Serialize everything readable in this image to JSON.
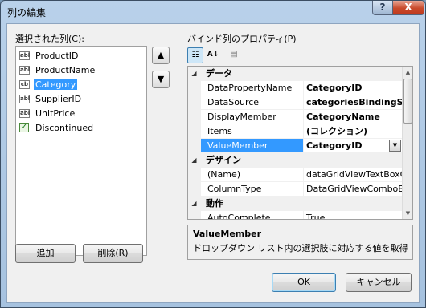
{
  "window": {
    "title": "列の編集",
    "help_glyph": "?",
    "close_glyph": "X"
  },
  "left": {
    "selected_columns_label": "選択された列(C):",
    "columns": [
      {
        "label": "ProductID",
        "icon": "textbox-column-icon",
        "icon_text": "abl"
      },
      {
        "label": "ProductName",
        "icon": "textbox-column-icon",
        "icon_text": "abl"
      },
      {
        "label": "Category",
        "icon": "combobox-column-icon",
        "icon_text": "cb"
      },
      {
        "label": "SupplierID",
        "icon": "textbox-column-icon",
        "icon_text": "abl"
      },
      {
        "label": "UnitPrice",
        "icon": "textbox-column-icon",
        "icon_text": "abl"
      },
      {
        "label": "Discontinued",
        "icon": "checkbox-column-icon",
        "icon_text": "✓"
      }
    ],
    "selected_column": "Category",
    "move_up_glyph": "▲",
    "move_down_glyph": "▼",
    "add_button": "追加",
    "remove_button": "削除(R)"
  },
  "right": {
    "properties_label": "バインド列のプロパティ(P)",
    "toolbar": {
      "categorized_glyph": "☷",
      "alphabetical_glyph": "A↓",
      "pages_glyph": "▤"
    },
    "grid": {
      "categories": [
        {
          "name": "データ",
          "rows": [
            {
              "name": "DataPropertyName",
              "value": "CategoryID",
              "bold": true
            },
            {
              "name": "DataSource",
              "value": "categoriesBindingSource",
              "bold": true
            },
            {
              "name": "DisplayMember",
              "value": "CategoryName",
              "bold": true
            },
            {
              "name": "Items",
              "value": "(コレクション)",
              "bold": true
            },
            {
              "name": "ValueMember",
              "value": "CategoryID",
              "bold": true,
              "selected": true
            }
          ]
        },
        {
          "name": "デザイン",
          "rows": [
            {
              "name": "(Name)",
              "value": "dataGridViewTextBoxColumn",
              "bold": false
            },
            {
              "name": "ColumnType",
              "value": "DataGridViewComboBoxColumn",
              "bold": false
            }
          ]
        },
        {
          "name": "動作",
          "rows": [
            {
              "name": "AutoComplete",
              "value": "True",
              "bold": false
            }
          ]
        }
      ],
      "collapse_glyph": "◢",
      "dropdown_glyph": "▼",
      "scroll_up_glyph": "▲",
      "scroll_down_glyph": "▼"
    },
    "description": {
      "title": "ValueMember",
      "text": "ドロップダウン リスト内の選択肢に対応する値を取得する..."
    }
  },
  "footer": {
    "ok_button": "OK",
    "cancel_button": "キャンセル"
  }
}
